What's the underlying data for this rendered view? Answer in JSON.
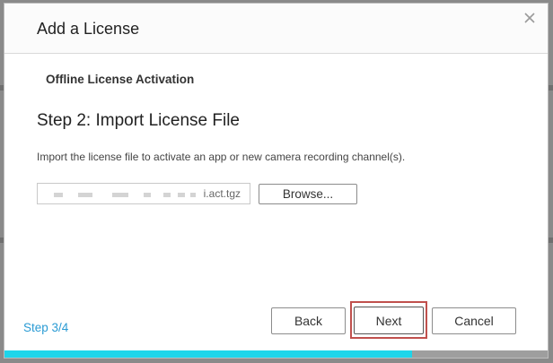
{
  "dialog": {
    "title": "Add a License",
    "subtitle": "Offline License Activation",
    "step_heading": "Step 2: Import License File",
    "description": "Import the license file to activate an app or new camera recording channel(s).",
    "file_input": {
      "value_suffix": "i.act.tgz"
    },
    "browse_label": "Browse...",
    "buttons": {
      "back": "Back",
      "next": "Next",
      "cancel": "Cancel"
    },
    "step_indicator": "Step 3/4",
    "progress_fraction": 0.75,
    "icons": {
      "close": "close-icon"
    }
  },
  "colors": {
    "accent": "#2a9bd4",
    "progress": "#1ed5ea",
    "highlight": "#c0504d"
  }
}
